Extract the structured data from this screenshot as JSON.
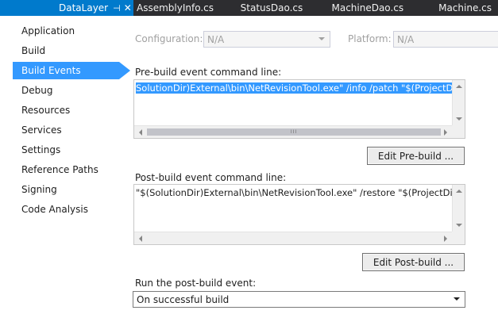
{
  "tabs": {
    "active": {
      "label": "DataLayer",
      "pin": "⊣",
      "close": "✕"
    },
    "others": [
      "AssemblyInfo.cs",
      "StatusDao.cs",
      "MachineDao.cs",
      "Machine.cs"
    ]
  },
  "sidebar": {
    "items": [
      {
        "label": "Application"
      },
      {
        "label": "Build"
      },
      {
        "label": "Build Events",
        "selected": true
      },
      {
        "label": "Debug"
      },
      {
        "label": "Resources"
      },
      {
        "label": "Services"
      },
      {
        "label": "Settings"
      },
      {
        "label": "Reference Paths"
      },
      {
        "label": "Signing"
      },
      {
        "label": "Code Analysis"
      }
    ]
  },
  "config": {
    "configuration_label": "Configuration:",
    "configuration_value": "N/A",
    "platform_label": "Platform:",
    "platform_value": "N/A"
  },
  "prebuild": {
    "label": "Pre-build event command line:",
    "text": "SolutionDir)External\\bin\\NetRevisionTool.exe\" /info /patch \"$(ProjectDir)\"",
    "button": "Edit Pre-build ..."
  },
  "postbuild": {
    "label": "Post-build event command line:",
    "text": "\"$(SolutionDir)External\\bin\\NetRevisionTool.exe\" /restore \"$(ProjectDir)\"",
    "button": "Edit Post-build ..."
  },
  "run": {
    "label": "Run the post-build event:",
    "value": "On successful build"
  },
  "scroll_grip": "III"
}
